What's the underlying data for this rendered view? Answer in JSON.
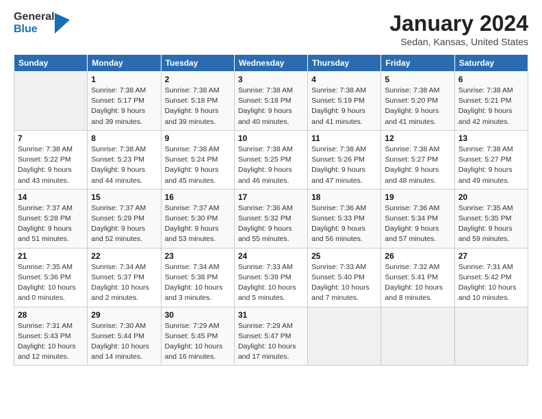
{
  "header": {
    "logo_line1": "General",
    "logo_line2": "Blue",
    "title": "January 2024",
    "subtitle": "Sedan, Kansas, United States"
  },
  "days_of_week": [
    "Sunday",
    "Monday",
    "Tuesday",
    "Wednesday",
    "Thursday",
    "Friday",
    "Saturday"
  ],
  "weeks": [
    [
      {
        "day": "",
        "info": ""
      },
      {
        "day": "1",
        "info": "Sunrise: 7:38 AM\nSunset: 5:17 PM\nDaylight: 9 hours\nand 39 minutes."
      },
      {
        "day": "2",
        "info": "Sunrise: 7:38 AM\nSunset: 5:18 PM\nDaylight: 9 hours\nand 39 minutes."
      },
      {
        "day": "3",
        "info": "Sunrise: 7:38 AM\nSunset: 5:18 PM\nDaylight: 9 hours\nand 40 minutes."
      },
      {
        "day": "4",
        "info": "Sunrise: 7:38 AM\nSunset: 5:19 PM\nDaylight: 9 hours\nand 41 minutes."
      },
      {
        "day": "5",
        "info": "Sunrise: 7:38 AM\nSunset: 5:20 PM\nDaylight: 9 hours\nand 41 minutes."
      },
      {
        "day": "6",
        "info": "Sunrise: 7:38 AM\nSunset: 5:21 PM\nDaylight: 9 hours\nand 42 minutes."
      }
    ],
    [
      {
        "day": "7",
        "info": "Sunrise: 7:38 AM\nSunset: 5:22 PM\nDaylight: 9 hours\nand 43 minutes."
      },
      {
        "day": "8",
        "info": "Sunrise: 7:38 AM\nSunset: 5:23 PM\nDaylight: 9 hours\nand 44 minutes."
      },
      {
        "day": "9",
        "info": "Sunrise: 7:38 AM\nSunset: 5:24 PM\nDaylight: 9 hours\nand 45 minutes."
      },
      {
        "day": "10",
        "info": "Sunrise: 7:38 AM\nSunset: 5:25 PM\nDaylight: 9 hours\nand 46 minutes."
      },
      {
        "day": "11",
        "info": "Sunrise: 7:38 AM\nSunset: 5:26 PM\nDaylight: 9 hours\nand 47 minutes."
      },
      {
        "day": "12",
        "info": "Sunrise: 7:38 AM\nSunset: 5:27 PM\nDaylight: 9 hours\nand 48 minutes."
      },
      {
        "day": "13",
        "info": "Sunrise: 7:38 AM\nSunset: 5:27 PM\nDaylight: 9 hours\nand 49 minutes."
      }
    ],
    [
      {
        "day": "14",
        "info": "Sunrise: 7:37 AM\nSunset: 5:28 PM\nDaylight: 9 hours\nand 51 minutes."
      },
      {
        "day": "15",
        "info": "Sunrise: 7:37 AM\nSunset: 5:29 PM\nDaylight: 9 hours\nand 52 minutes."
      },
      {
        "day": "16",
        "info": "Sunrise: 7:37 AM\nSunset: 5:30 PM\nDaylight: 9 hours\nand 53 minutes."
      },
      {
        "day": "17",
        "info": "Sunrise: 7:36 AM\nSunset: 5:32 PM\nDaylight: 9 hours\nand 55 minutes."
      },
      {
        "day": "18",
        "info": "Sunrise: 7:36 AM\nSunset: 5:33 PM\nDaylight: 9 hours\nand 56 minutes."
      },
      {
        "day": "19",
        "info": "Sunrise: 7:36 AM\nSunset: 5:34 PM\nDaylight: 9 hours\nand 57 minutes."
      },
      {
        "day": "20",
        "info": "Sunrise: 7:35 AM\nSunset: 5:35 PM\nDaylight: 9 hours\nand 59 minutes."
      }
    ],
    [
      {
        "day": "21",
        "info": "Sunrise: 7:35 AM\nSunset: 5:36 PM\nDaylight: 10 hours\nand 0 minutes."
      },
      {
        "day": "22",
        "info": "Sunrise: 7:34 AM\nSunset: 5:37 PM\nDaylight: 10 hours\nand 2 minutes."
      },
      {
        "day": "23",
        "info": "Sunrise: 7:34 AM\nSunset: 5:38 PM\nDaylight: 10 hours\nand 3 minutes."
      },
      {
        "day": "24",
        "info": "Sunrise: 7:33 AM\nSunset: 5:39 PM\nDaylight: 10 hours\nand 5 minutes."
      },
      {
        "day": "25",
        "info": "Sunrise: 7:33 AM\nSunset: 5:40 PM\nDaylight: 10 hours\nand 7 minutes."
      },
      {
        "day": "26",
        "info": "Sunrise: 7:32 AM\nSunset: 5:41 PM\nDaylight: 10 hours\nand 8 minutes."
      },
      {
        "day": "27",
        "info": "Sunrise: 7:31 AM\nSunset: 5:42 PM\nDaylight: 10 hours\nand 10 minutes."
      }
    ],
    [
      {
        "day": "28",
        "info": "Sunrise: 7:31 AM\nSunset: 5:43 PM\nDaylight: 10 hours\nand 12 minutes."
      },
      {
        "day": "29",
        "info": "Sunrise: 7:30 AM\nSunset: 5:44 PM\nDaylight: 10 hours\nand 14 minutes."
      },
      {
        "day": "30",
        "info": "Sunrise: 7:29 AM\nSunset: 5:45 PM\nDaylight: 10 hours\nand 16 minutes."
      },
      {
        "day": "31",
        "info": "Sunrise: 7:29 AM\nSunset: 5:47 PM\nDaylight: 10 hours\nand 17 minutes."
      },
      {
        "day": "",
        "info": ""
      },
      {
        "day": "",
        "info": ""
      },
      {
        "day": "",
        "info": ""
      }
    ]
  ]
}
